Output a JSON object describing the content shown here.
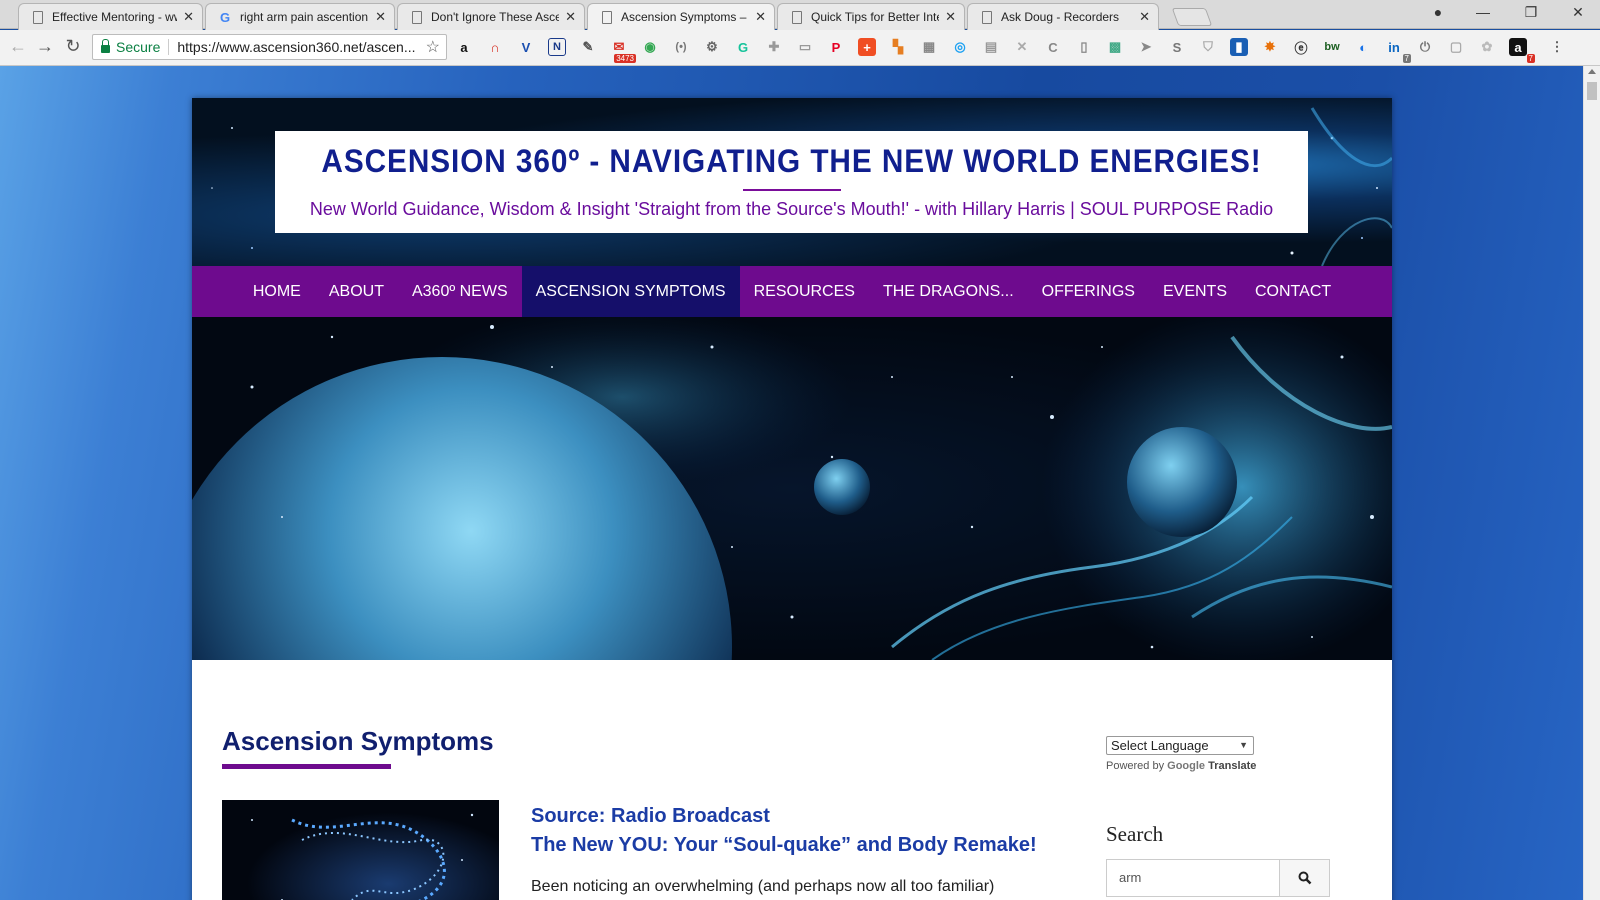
{
  "browser": {
    "tabs": [
      {
        "title": "Effective Mentoring - ww",
        "icon": "doc",
        "active": false
      },
      {
        "title": "right arm pain ascention",
        "icon": "google",
        "active": false
      },
      {
        "title": "Don't Ignore These Ascen",
        "icon": "doc",
        "active": false
      },
      {
        "title": "Ascension Symptoms – A",
        "icon": "doc",
        "active": true
      },
      {
        "title": "Quick Tips for Better Inte",
        "icon": "doc",
        "active": false
      },
      {
        "title": "Ask Doug - Recorders",
        "icon": "doc",
        "active": false
      }
    ],
    "secure_label": "Secure",
    "url": "https://www.ascension360.net/ascen...",
    "extension_badges": {
      "gmail": "3473",
      "linkedin": "7",
      "amazon": "7"
    }
  },
  "site": {
    "title": "ASCENSION 360º - NAVIGATING THE NEW WORLD ENERGIES!",
    "tagline": "New World Guidance, Wisdom & Insight 'Straight from the Source's Mouth!' - with Hillary Harris | SOUL PURPOSE Radio",
    "nav": [
      {
        "label": "HOME",
        "active": false
      },
      {
        "label": "ABOUT",
        "active": false
      },
      {
        "label": "A360º NEWS",
        "active": false
      },
      {
        "label": "ASCENSION SYMPTOMS",
        "active": true
      },
      {
        "label": "RESOURCES",
        "active": false
      },
      {
        "label": "THE DRAGONS...",
        "active": false
      },
      {
        "label": "OFFERINGS",
        "active": false
      },
      {
        "label": "EVENTS",
        "active": false
      },
      {
        "label": "CONTACT",
        "active": false
      }
    ],
    "colors": {
      "nav_bg": "#6e0b8e",
      "nav_active": "#150f6a",
      "title": "#101f8e",
      "link": "#1b3ca5"
    }
  },
  "content": {
    "page_title": "Ascension Symptoms",
    "post": {
      "source": "Source: Radio Broadcast",
      "title": "The New YOU: Your “Soul-quake” and Body Remake!",
      "excerpt": "Been noticing an overwhelming (and perhaps now all too familiar)"
    }
  },
  "sidebar": {
    "language_select": "Select Language",
    "powered_by": "Powered by",
    "google": "Google",
    "translate": "Translate",
    "search_heading": "Search",
    "search_value": "arm"
  }
}
